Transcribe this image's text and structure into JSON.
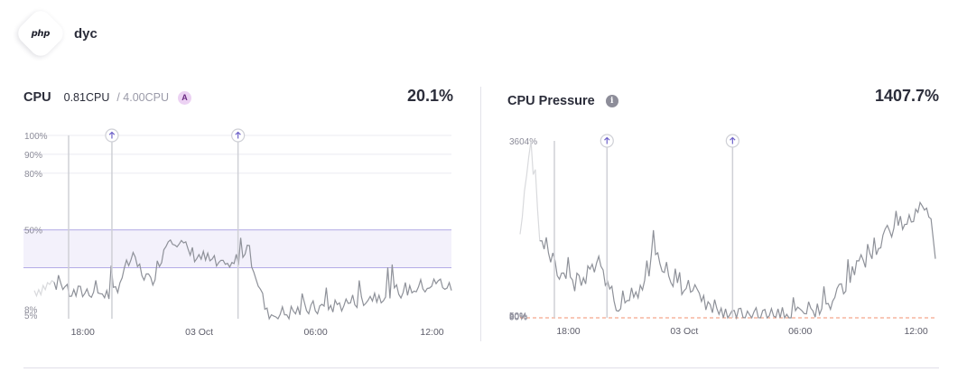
{
  "app": {
    "logo_text": "php",
    "name": "dyc"
  },
  "cpu": {
    "title": "CPU",
    "used": "0.81CPU",
    "limit": "/ 4.00CPU",
    "badge": "A",
    "value": "20.1%"
  },
  "pressure": {
    "title": "CPU Pressure",
    "info_icon": "i",
    "value": "1407.7%"
  },
  "colors": {
    "line": "#8e9199",
    "line_faded": "#d9dadd",
    "grid": "#ebebf0",
    "marker": "#cfd0d6",
    "marker_icon": "#6f63c9",
    "band_fill": "#f3f1fb",
    "band_stroke": "#b4abe6",
    "baseline": "#f2916f"
  },
  "chart_data": [
    {
      "type": "line",
      "name": "cpu",
      "x": [
        "15:30",
        "16:30",
        "17:30",
        "18:30",
        "19:30",
        "20:30",
        "21:30",
        "22:30",
        "23:30",
        "00:30",
        "01:30",
        "02:30",
        "03:30",
        "04:30",
        "05:30",
        "06:30",
        "07:30",
        "08:30",
        "09:30",
        "10:30",
        "11:30",
        "12:30",
        "13:00"
      ],
      "values": [
        18,
        22,
        16,
        18,
        15,
        35,
        22,
        48,
        38,
        34,
        28,
        42,
        5,
        6,
        8,
        9,
        11,
        14,
        16,
        18,
        20,
        22,
        18
      ],
      "ylim": [
        3,
        100
      ],
      "y_ticks": [
        {
          "label": "100%",
          "value": 100
        },
        {
          "label": "90%",
          "value": 90
        },
        {
          "label": "80%",
          "value": 80
        },
        {
          "label": "50%",
          "value": 50
        },
        {
          "label": "8%",
          "value": 8
        },
        {
          "label": "5%",
          "value": 5
        }
      ],
      "x_ticks": [
        {
          "label": "18:00",
          "x": "18:00"
        },
        {
          "label": "03 Oct",
          "x": "00:00"
        },
        {
          "label": "06:00",
          "x": "06:00"
        },
        {
          "label": "12:00",
          "x": "12:00"
        }
      ],
      "band": [
        30,
        50
      ],
      "event_markers": [
        "19:30",
        "02:00"
      ],
      "grid": true
    },
    {
      "type": "line",
      "name": "cpu-pressure",
      "x": [
        "15:30",
        "16:00",
        "16:30",
        "17:30",
        "18:30",
        "19:30",
        "20:30",
        "21:30",
        "22:30",
        "23:30",
        "00:30",
        "01:30",
        "02:30",
        "03:30",
        "04:30",
        "05:30",
        "06:30",
        "07:30",
        "08:30",
        "09:30",
        "10:30",
        "11:30",
        "12:30",
        "13:00"
      ],
      "values": [
        1500,
        3604,
        1800,
        900,
        700,
        1100,
        300,
        500,
        1300,
        800,
        500,
        200,
        0,
        50,
        80,
        60,
        120,
        300,
        800,
        1300,
        1700,
        2000,
        2400,
        1407
      ],
      "ylim": [
        0,
        3604
      ],
      "y_ticks": [
        {
          "label": "3604%",
          "value": 3604
        },
        {
          "label": "90%",
          "value": 0
        },
        {
          "label": "80%",
          "value": 0
        },
        {
          "label": "50%",
          "value": 0
        }
      ],
      "x_ticks": [
        {
          "label": "18:00",
          "x": "18:00"
        },
        {
          "label": "03 Oct",
          "x": "00:00"
        },
        {
          "label": "06:00",
          "x": "06:00"
        },
        {
          "label": "12:00",
          "x": "12:00"
        }
      ],
      "event_markers": [
        "20:00",
        "02:30"
      ],
      "baseline": 0,
      "grid": false
    }
  ]
}
